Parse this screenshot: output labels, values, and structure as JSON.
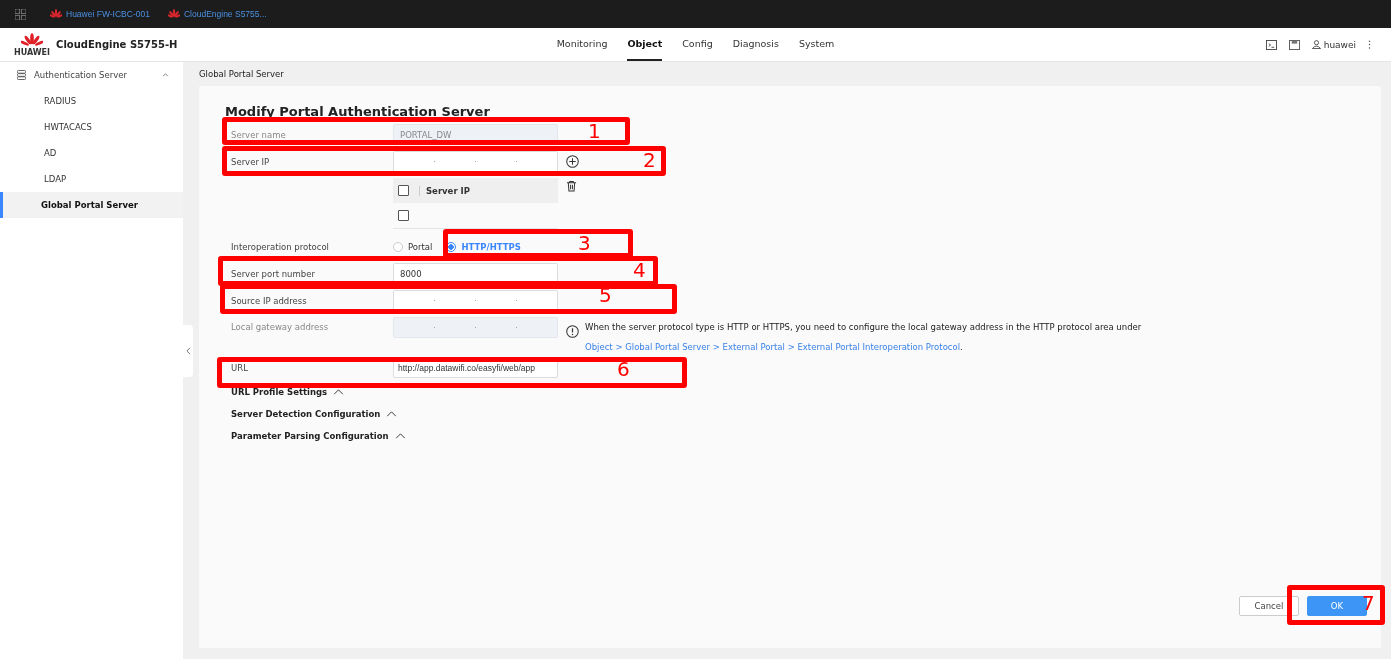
{
  "top_bar": {
    "tabs": [
      {
        "label": "Huawei FW-ICBC-001"
      },
      {
        "label": "CloudEngine S5755..."
      }
    ]
  },
  "header": {
    "logo_text": "HUAWEI",
    "product": "CloudEngine S5755-H",
    "nav": [
      {
        "label": "Monitoring",
        "selected": false
      },
      {
        "label": "Object",
        "selected": true
      },
      {
        "label": "Config",
        "selected": false
      },
      {
        "label": "Diagnosis",
        "selected": false
      },
      {
        "label": "System",
        "selected": false
      }
    ],
    "user": "huawei"
  },
  "sidebar": {
    "group": {
      "label": "Authentication Server",
      "expanded": true
    },
    "items": [
      {
        "label": "RADIUS",
        "selected": false
      },
      {
        "label": "HWTACACS",
        "selected": false
      },
      {
        "label": "AD",
        "selected": false
      },
      {
        "label": "LDAP",
        "selected": false
      },
      {
        "label": "Global Portal Server",
        "selected": true
      }
    ]
  },
  "breadcrumb": "Global Portal Server",
  "form": {
    "title": "Modify Portal Authentication Server",
    "fields": [
      {
        "kind": "text",
        "label": "Server name",
        "value": "PORTAL_DW",
        "disabled": true
      },
      {
        "kind": "ip",
        "label": "Server IP",
        "disabled": false,
        "add_button": true
      },
      {
        "kind": "ip_table",
        "column": "Server IP",
        "header_checked": false,
        "rows": [
          {
            "checked": false
          }
        ]
      },
      {
        "kind": "radio",
        "label": "Interoperation protocol",
        "options": [
          {
            "label": "Portal",
            "selected": false
          },
          {
            "label": "HTTP/HTTPS",
            "selected": true
          }
        ]
      },
      {
        "kind": "text",
        "label": "Server port number",
        "value": "8000",
        "disabled": false
      },
      {
        "kind": "ip",
        "label": "Source IP address",
        "disabled": false
      },
      {
        "kind": "ip",
        "label": "Local gateway address",
        "disabled": true,
        "hint": {
          "text": "When the server protocol type is HTTP or HTTPS, you need to configure the local gateway address in the HTTP protocol area under ",
          "link": "Object > Global Portal Server > External Portal > External Portal Interoperation Protocol",
          "end": "."
        }
      },
      {
        "kind": "text",
        "label": "URL",
        "value": "http://app.datawifi.co/easyfi/web/app",
        "disabled": false
      }
    ],
    "sections": [
      {
        "label": "URL Profile Settings"
      },
      {
        "label": "Server Detection Configuration"
      },
      {
        "label": "Parameter Parsing Configuration"
      }
    ]
  },
  "buttons": [
    {
      "label": "Cancel",
      "kind": "secondary"
    },
    {
      "label": "OK",
      "kind": "primary"
    }
  ],
  "annotations": [
    {
      "number": "1"
    },
    {
      "number": "2"
    },
    {
      "number": "3"
    },
    {
      "number": "4"
    },
    {
      "number": "5"
    },
    {
      "number": "6"
    },
    {
      "number": "7"
    }
  ]
}
